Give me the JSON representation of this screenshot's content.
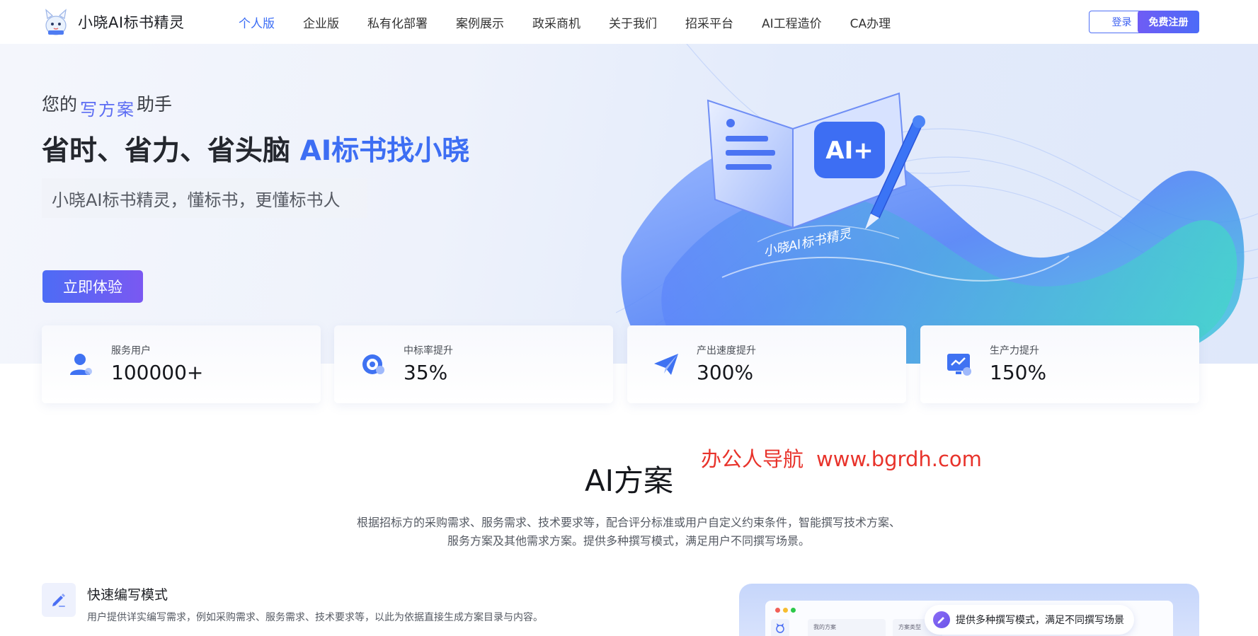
{
  "brand": {
    "name": "小晓AI标书精灵"
  },
  "nav": {
    "items": [
      {
        "label": "个人版",
        "active": true
      },
      {
        "label": "企业版"
      },
      {
        "label": "私有化部署"
      },
      {
        "label": "案例展示"
      },
      {
        "label": "政采商机"
      },
      {
        "label": "关于我们"
      },
      {
        "label": "招采平台"
      },
      {
        "label": "AI工程造价"
      },
      {
        "label": "CA办理"
      }
    ],
    "login_label": "登录",
    "register_label": "免费注册"
  },
  "hero": {
    "sub_prefix": "您的",
    "sub_highlight": "写方案",
    "sub_suffix": "助手",
    "title_plain": "省时、省力、省头脑 ",
    "title_accent": "AI标书找小晓",
    "slogan": "小晓AI标书精灵，懂标书，更懂标书人",
    "cta_label": "立即体验",
    "art_caption": "小晓AI标书精灵",
    "art_badge": "AI+"
  },
  "stats": [
    {
      "label": "服务用户",
      "value": "100000+",
      "icon": "user-icon"
    },
    {
      "label": "中标率提升",
      "value": "35%",
      "icon": "target-icon"
    },
    {
      "label": "产出速度提升",
      "value": "300%",
      "icon": "paper-plane-icon"
    },
    {
      "label": "生产力提升",
      "value": "150%",
      "icon": "monitor-chart-icon"
    }
  ],
  "watermark": {
    "name": "办公人导航",
    "url": "www.bgrdh.com"
  },
  "section": {
    "title": "AI方案",
    "desc_line1": "根据招标方的采购需求、服务需求、技术要求等，配合评分标准或用户自定义约束条件，智能撰写技术方案、",
    "desc_line2": "服务方案及其他需求方案。提供多种撰写模式，满足用户不同撰写场景。"
  },
  "mode": {
    "title": "快速编写模式",
    "desc": "用户提供详实编写需求，例如采购需求、服务需求、技术要求等，以此为依据直接生成方案目录与内容。",
    "icon": "pencil-icon"
  },
  "preview": {
    "card1": "我的方案",
    "card2": "方案类型",
    "pill_text": "提供多种撰写模式，满足不同撰写场景"
  },
  "colors": {
    "accent": "#3d6ef3",
    "purple": "#6f5cf5",
    "watermark": "#e8332b"
  }
}
